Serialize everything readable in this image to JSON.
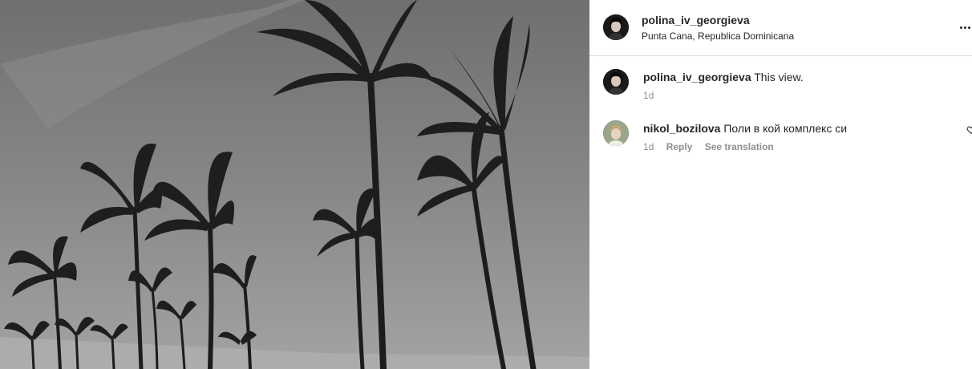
{
  "post": {
    "username": "polina_iv_georgieva",
    "location": "Punta Cana, Republica Dominicana",
    "icons": {
      "avatar": "avatar",
      "more": "more-options-icon"
    }
  },
  "comments": [
    {
      "username": "polina_iv_georgieva",
      "text": "This view.",
      "time": "1d"
    },
    {
      "username": "nikol_bozilova",
      "text": "Поли в кой комплекс си",
      "time": "1d",
      "reply_label": "Reply",
      "translation_label": "See translation"
    }
  ],
  "colors": {
    "primary_text": "#262626",
    "secondary_text": "#8e8e8e",
    "divider": "#dbdbdb"
  }
}
